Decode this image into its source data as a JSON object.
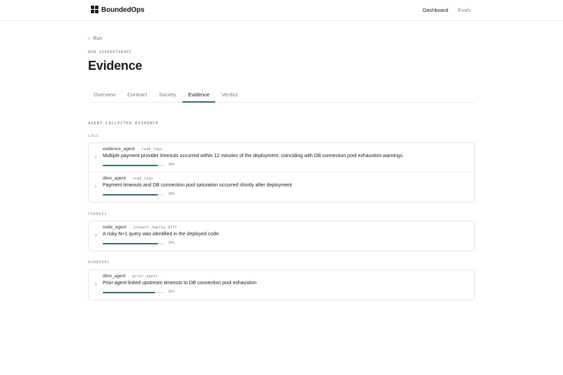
{
  "header": {
    "brand": "BoundedOps",
    "nav": {
      "dashboard": "Dashboard",
      "evals": "Evals"
    }
  },
  "back_link": {
    "label": "Run"
  },
  "run_id": "RUN_299A607889EC",
  "page_title": "Evidence",
  "tabs": [
    {
      "label": "Overview",
      "active": false
    },
    {
      "label": "Contract",
      "active": false
    },
    {
      "label": "Society",
      "active": false
    },
    {
      "label": "Evidence",
      "active": true
    },
    {
      "label": "Verdict",
      "active": false
    }
  ],
  "section_title": "AGENT-COLLECTED EVIDENCE",
  "groups": {
    "logs": {
      "label": "LOGS",
      "items": [
        {
          "agent": "evidence_agent",
          "tool": "read_logs",
          "description": "Multiple payment provider timeouts occurred within 12 minutes of the deployment, coinciding with DB connection pool exhaustion warnings.",
          "confidence": 0.9,
          "confidence_label": "90%"
        },
        {
          "agent": "dbre_agent",
          "tool": "read_logs",
          "description": "Payment timeouts and DB connection pool saturation occurred shortly after deployment",
          "confidence": 0.9,
          "confidence_label": "90%"
        }
      ]
    },
    "changes": {
      "label": "CHANGES",
      "items": [
        {
          "agent": "code_agent",
          "tool": "inspect_deploy_diff",
          "description": "A risky N+1 query was identified in the deployed code.",
          "confidence": 0.9,
          "confidence_label": "90%"
        }
      ]
    },
    "runbooks": {
      "label": "RUNBOOKS",
      "items": [
        {
          "agent": "dbre_agent",
          "tool": "prior_agent",
          "description": "Prior agent linked upstream timeouts to DB connection pool exhaustion",
          "confidence": 0.85,
          "confidence_label": "85%"
        }
      ]
    }
  },
  "colors": {
    "accent": "#2f6f73",
    "track": "#e8e8e8"
  }
}
